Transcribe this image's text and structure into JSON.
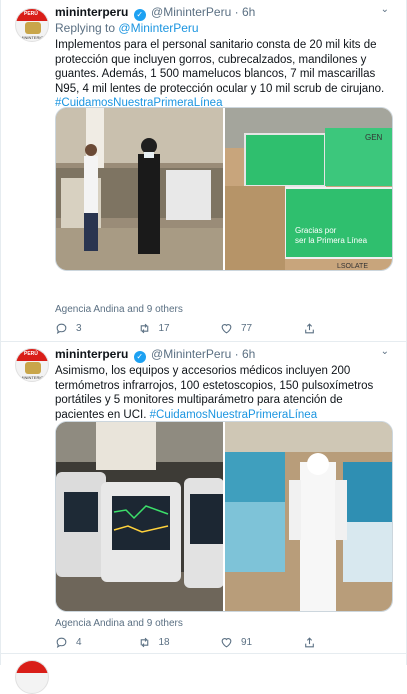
{
  "tweets": [
    {
      "name": "mininterperu",
      "handle": "@MininterPeru",
      "dot": "·",
      "time": "6h",
      "replying_prefix": "Replying to",
      "replying_to": "@MininterPeru",
      "text": "Implementos para el personal sanitario consta de 20 mil kits de protección que incluyen gorros, cubrecalzados, mandilones y guantes. Además, 1 500 mamelucos blancos, 7 mil mascarillas N95, 4 mil lentes de protección ocular y 10 mil scrub de cirujano.",
      "hashtag": "#CuidamosNuestraPrimeraLínea",
      "liked_by": "Agencia Andina and 9 others",
      "replies": "3",
      "retweets": "17",
      "likes": "77"
    },
    {
      "name": "mininterperu",
      "handle": "@MininterPeru",
      "dot": "·",
      "time": "6h",
      "text": "Asimismo, los equipos y accesorios médicos incluyen 200 termómetros infrarrojos, 100 estetoscopios, 150 pulsoxímetros portátiles y 5 monitores multiparámetro para atención de pacientes en UCI.",
      "hashtag": "#CuidamosNuestraPrimeraLínea",
      "liked_by": "Agencia Andina and 9 others",
      "replies": "4",
      "retweets": "18",
      "likes": "91"
    }
  ],
  "avatar": {
    "flag_text": "PERÚ",
    "subtitle": "MININTERIOR"
  },
  "photo1": {
    "box_label_1": "Gracias por",
    "box_label_2": "ser la Primera Línea",
    "box_brand": "GEN",
    "box_side": "LSOLATE"
  },
  "colors": {
    "accent": "#1b95e0",
    "verified": "#1da1f2",
    "muted": "#5b7083",
    "border": "#e6ecf0"
  }
}
